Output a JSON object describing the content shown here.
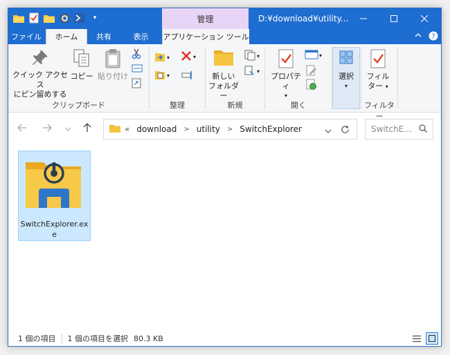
{
  "window": {
    "title": "D:¥download¥utility...",
    "context_tab_header": "管理"
  },
  "tabs": [
    {
      "label": "ファイル"
    },
    {
      "label": "ホーム"
    },
    {
      "label": "共有"
    },
    {
      "label": "表示"
    },
    {
      "label": "アプリケーション ツール"
    }
  ],
  "ribbon": {
    "clipboard": {
      "pin_label_1": "クイック アクセス",
      "pin_label_2": "にピン留めする",
      "copy_label": "コピー",
      "paste_label": "貼り付け",
      "group_label": "クリップボード"
    },
    "organize": {
      "group_label": "整理"
    },
    "new": {
      "new_folder_label_1": "新しい",
      "new_folder_label_2": "フォルダー",
      "group_label": "新規"
    },
    "open": {
      "properties_label": "プロパティ",
      "group_label": "開く"
    },
    "select": {
      "label": "選択"
    },
    "filter": {
      "label_1": "フィル",
      "label_2": "ター",
      "group_label": "フィルター"
    }
  },
  "navigation": {
    "breadcrumb": [
      "download",
      "utility",
      "SwitchExplorer"
    ],
    "overflow_marker": "«",
    "search_placeholder": "SwitchE..."
  },
  "files": [
    {
      "name": "SwitchExplorer.exe",
      "selected": true
    }
  ],
  "status": {
    "item_count": "1 個の項目",
    "selection": "1 個の項目を選択",
    "size": "80.3 KB"
  },
  "colors": {
    "titlebar": "#1e6dd0",
    "context_tab": "#e8d4f6",
    "selection_bg": "#cce8ff",
    "folder_yellow": "#f5c542",
    "app_blue": "#2c75c9"
  }
}
